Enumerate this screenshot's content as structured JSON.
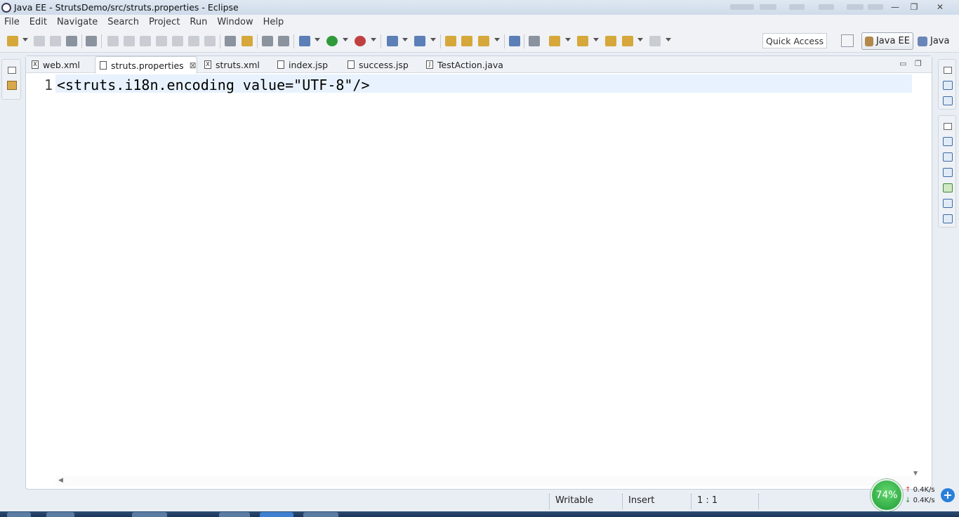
{
  "window": {
    "title": "Java EE - StrutsDemo/src/struts.properties - Eclipse",
    "controls": {
      "minimize": "—",
      "maximize": "❐",
      "close": "✕"
    }
  },
  "menu": [
    "File",
    "Edit",
    "Navigate",
    "Search",
    "Project",
    "Run",
    "Window",
    "Help"
  ],
  "toolbar": {
    "quick_access": "Quick Access",
    "perspectives": [
      {
        "label": "Java EE",
        "active": true
      },
      {
        "label": "Java",
        "active": false
      }
    ]
  },
  "editor": {
    "tabs": [
      {
        "label": "web.xml",
        "icon": "X",
        "active": false
      },
      {
        "label": "struts.properties",
        "icon": "",
        "active": true,
        "close": "⊠"
      },
      {
        "label": "struts.xml",
        "icon": "X",
        "active": false
      },
      {
        "label": "index.jsp",
        "icon": "",
        "active": false
      },
      {
        "label": "success.jsp",
        "icon": "",
        "active": false
      },
      {
        "label": "TestAction.java",
        "icon": "J",
        "active": false
      }
    ],
    "view_controls": {
      "minimize": "▭",
      "maximize": "❐"
    },
    "lines": [
      {
        "number": "1",
        "text": "<struts.i18n.encoding value=\"UTF-8\"/>"
      }
    ]
  },
  "status": {
    "write_mode": "Writable",
    "insert_mode": "Insert",
    "position": "1 : 1"
  },
  "widget": {
    "percent": "74%",
    "upload": "0.4K/s",
    "download": "0.4K/s",
    "plus": "+"
  }
}
